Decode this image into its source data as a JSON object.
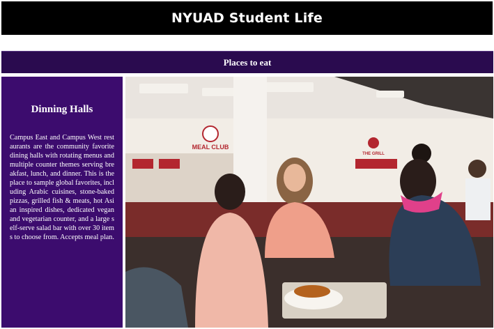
{
  "header": {
    "title": "NYUAD Student Life"
  },
  "section": {
    "title": "Places to eat"
  },
  "card": {
    "title": "Dinning Halls",
    "description": "Campus East and Campus West restaurants are the community favorite dining halls with rotating menus and multiple counter themes serving breakfast, lunch, and dinner. This is the place to sample global favorites, including Arabic cuisines, stone-baked pizzas, grilled fish & meats, hot Asian inspired dishes, dedicated vegan and vegetarian counter, and a large self-serve salad bar with over 30 items to choose from. Accepts meal plan."
  },
  "photo": {
    "signs": {
      "meal_club": "MEAL CLUB",
      "grill": "THE GRILL"
    }
  },
  "colors": {
    "header_bg": "#000000",
    "section_bg": "#2a0b4f",
    "panel_bg": "#3c0c6e",
    "text": "#ffffff"
  }
}
